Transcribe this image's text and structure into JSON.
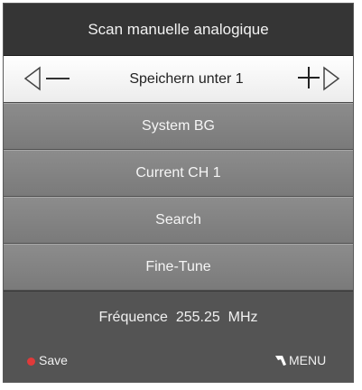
{
  "title": "Scan manuelle analogique",
  "selected_item": {
    "label": "Speichern unter 1",
    "left_arrow_icon": "left-triangle-icon",
    "decrement_icon": "minus-icon",
    "increment_icon": "plus-icon",
    "right_arrow_icon": "right-triangle-icon"
  },
  "menu_items": [
    {
      "label": "System BG"
    },
    {
      "label": "Current CH 1"
    },
    {
      "label": "Search"
    },
    {
      "label": "Fine-Tune"
    }
  ],
  "footer": {
    "frequency": "Fréquence  255.25  MHz",
    "save_hint": "Save",
    "save_icon": "red-dot-icon",
    "menu_hint": "MENU",
    "menu_icon": "return-arrow-icon"
  },
  "colors": {
    "title_bg": "#353535",
    "selected_bg": "#ffffff",
    "item_bg": "#858585",
    "footer_bg": "#545454",
    "save_dot": "#e03a3a"
  }
}
